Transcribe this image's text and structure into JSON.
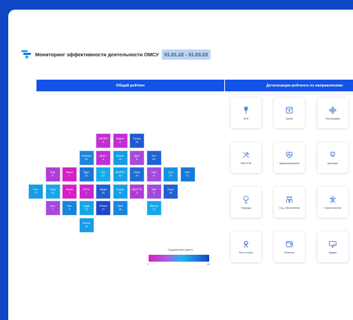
{
  "header": {
    "title": "Мониторинг эффективности деятельности ОМСУ",
    "period": "01.01.22 - 31.03.23"
  },
  "sections": {
    "overall": "Общий рейтинг",
    "detail": "Детализация рейтинга по направлениям"
  },
  "tiles": [
    {
      "name": "ЖЕЛЕЗ",
      "rank": "3",
      "color": "#c42ed3"
    },
    {
      "name": "Жирен",
      "rank": "4",
      "color": "#c22ed4"
    },
    {
      "name": "Почыр",
      "rank": "26",
      "color": "#2159d3"
    },
    {
      "name": "Кинешм",
      "rank": "20",
      "color": "#1d86dc"
    },
    {
      "name": "Днегт",
      "rank": "3",
      "color": "#be30d5"
    },
    {
      "name": "Жигал",
      "rank": "15",
      "color": "#179be4"
    },
    {
      "name": "Курс",
      "rank": "6",
      "color": "#a749dd"
    },
    {
      "name": "Зол",
      "rank": "25",
      "color": "#1e63d5"
    },
    {
      "name": "Бор",
      "rank": "5",
      "color": "#b23cda"
    },
    {
      "name": "Вычм",
      "rank": "1",
      "color": "#d61fc6"
    },
    {
      "name": "Курч",
      "rank": "22",
      "color": "#1f73d7"
    },
    {
      "name": "Ост",
      "rank": "12",
      "color": "#15aaea"
    },
    {
      "name": "ЖИРОЛ",
      "rank": "15",
      "color": "#16a2e6"
    },
    {
      "name": "Шатр",
      "rank": "23",
      "color": "#1d6cd6"
    },
    {
      "name": "Чер",
      "rank": "6",
      "color": "#a44ade"
    },
    {
      "name": "Сон",
      "rank": "20",
      "color": "#1692e2"
    },
    {
      "name": "Каст",
      "rank": "17",
      "color": "#1778dc"
    },
    {
      "name": "Рыл",
      "rank": "17",
      "color": "#189ce4"
    },
    {
      "name": "Глуш",
      "rank": "10",
      "color": "#1aa5e8"
    },
    {
      "name": "Льгов",
      "rank": "1",
      "color": "#d71fc6"
    },
    {
      "name": "КУРЧ",
      "rank": "1",
      "color": "#c627cf"
    },
    {
      "name": "Медв",
      "rank": "24",
      "color": "#1f5fd4"
    },
    {
      "name": "Солнц",
      "rank": "15",
      "color": "#16a0e6"
    },
    {
      "name": "ЩИГРЫ",
      "rank": "3",
      "color": "#b23bd8"
    },
    {
      "name": "Тим",
      "rank": "8",
      "color": "#a04cdd"
    },
    {
      "name": "Горш",
      "rank": "26",
      "color": "#2160d4"
    },
    {
      "name": "Кор",
      "rank": "7",
      "color": "#a64ade"
    },
    {
      "name": "Бол",
      "rank": "9",
      "color": "#1484dd"
    },
    {
      "name": "Судж",
      "rank": "13",
      "color": "#15a6e8"
    },
    {
      "name": "Обоян",
      "rank": "27",
      "color": "#1f47c9"
    },
    {
      "name": "Прис",
      "rank": "18",
      "color": "#1786df"
    },
    {
      "name": "Манту",
      "rank": "14",
      "color": "#15a7e9"
    },
    {
      "name": "Белов",
      "rank": "16",
      "color": "#179de5"
    }
  ],
  "legend": {
    "title": "Средний балл (рангт)",
    "min": "1",
    "max": "31"
  },
  "cards": [
    {
      "label": "АПК",
      "icon": "wheat-icon"
    },
    {
      "label": "Архив",
      "icon": "archive-box-icon"
    },
    {
      "label": "Фотографии",
      "icon": "sunflower-icon"
    },
    {
      "label": "ЖКХ/ТЭК",
      "icon": "wrench-screwdriver-icon"
    },
    {
      "label": "Здравоохранение",
      "icon": "heart-pulse-icon"
    },
    {
      "label": "Культура",
      "icon": "theater-masks-icon"
    },
    {
      "label": "Природа",
      "icon": "tree-icon"
    },
    {
      "label": "Соц. обеспечение",
      "icon": "family-icon"
    },
    {
      "label": "Строительство",
      "icon": "builder-icon"
    },
    {
      "label": "Физ. и спорт",
      "icon": "athlete-icon"
    },
    {
      "label": "Финансы",
      "icon": "wallet-icon"
    },
    {
      "label": "Цифра",
      "icon": "monitor-icon"
    }
  ],
  "colors": {
    "page_frame": "#0e46c4",
    "section_bar": "#1353e8",
    "icon_stroke": "#3a6fd8"
  }
}
